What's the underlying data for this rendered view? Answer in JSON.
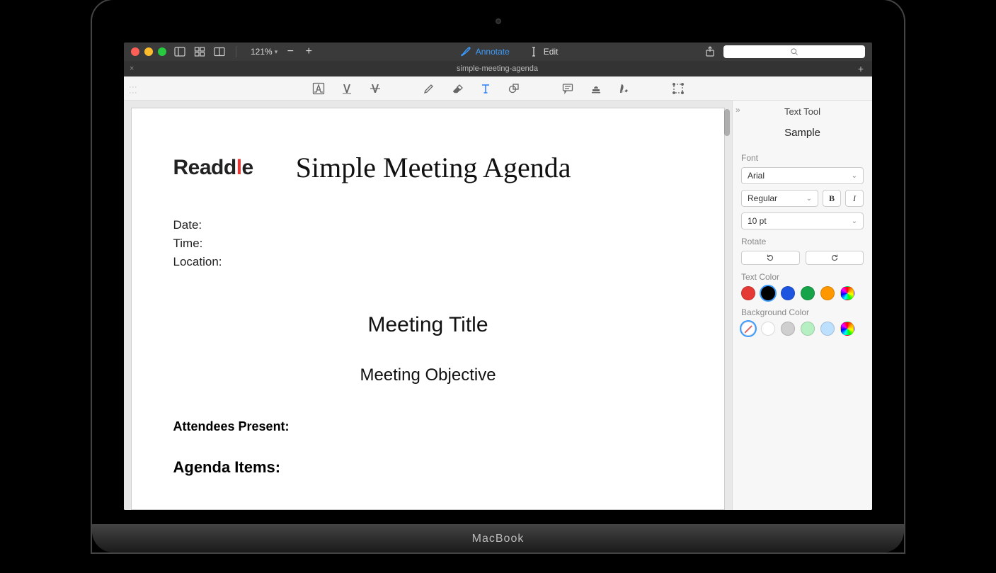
{
  "titlebar": {
    "zoom": "121%",
    "annotate_label": "Annotate",
    "edit_label": "Edit"
  },
  "tab": {
    "title": "simple-meeting-agenda"
  },
  "document": {
    "logo_a": "Readd",
    "logo_b": "l",
    "logo_c": "e",
    "title": "Simple Meeting Agenda",
    "date_label": "Date:",
    "time_label": "Time:",
    "location_label": "Location:",
    "meeting_title": "Meeting Title",
    "meeting_objective": "Meeting Objective",
    "attendees_label": "Attendees Present:",
    "agenda_label": "Agenda Items:"
  },
  "panel": {
    "title": "Text Tool",
    "sample": "Sample",
    "font_label": "Font",
    "font_family": "Arial",
    "font_weight": "Regular",
    "font_size": "10 pt",
    "rotate_label": "Rotate",
    "text_color_label": "Text Color",
    "text_colors": [
      "#e53935",
      "#000000",
      "#1e55e0",
      "#17a349",
      "#ff9800"
    ],
    "text_color_selected": 1,
    "bg_color_label": "Background Color",
    "bg_colors_tint": [
      "#ffffff",
      "#cfcfcf",
      "#b6f0c2",
      "#bde0ff"
    ]
  },
  "device": {
    "label": "MacBook"
  }
}
